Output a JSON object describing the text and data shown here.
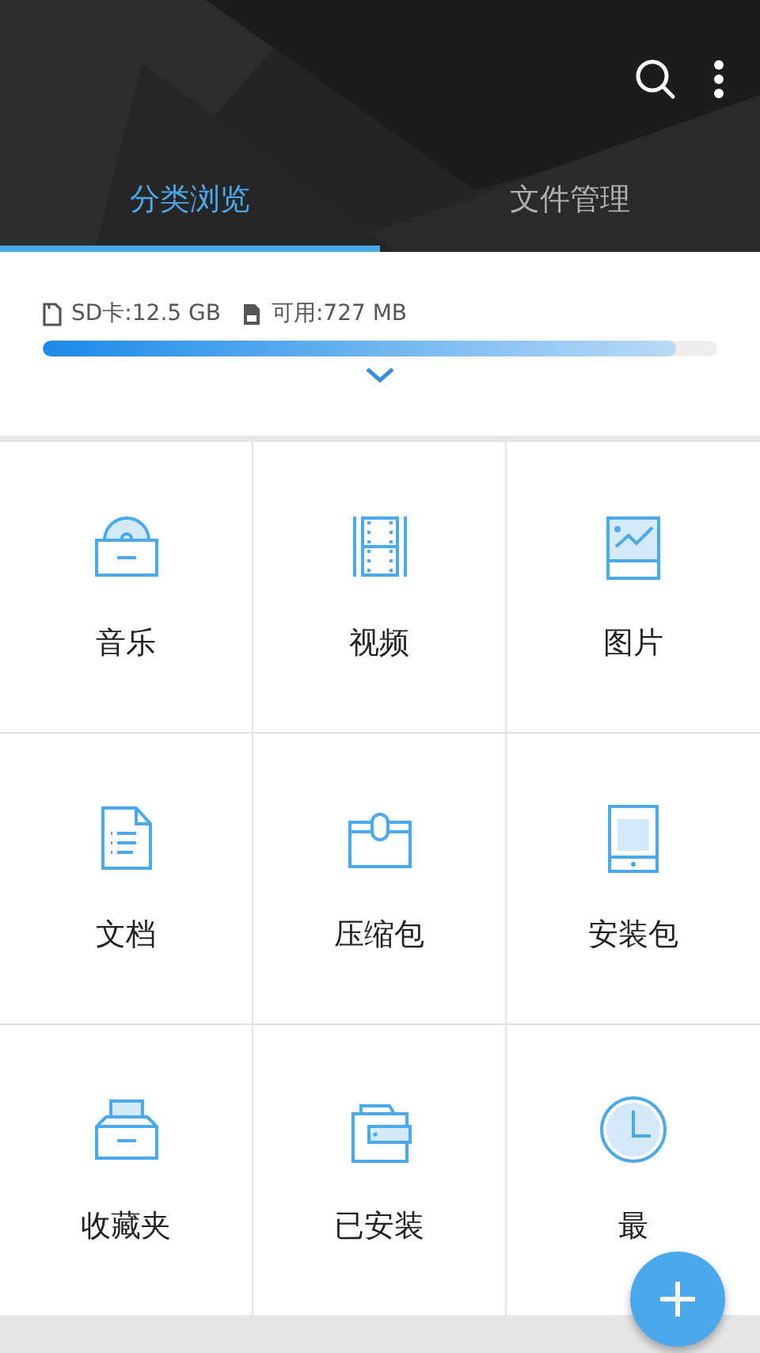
{
  "tabs": [
    {
      "label": "分类浏览",
      "selected": true
    },
    {
      "label": "文件管理",
      "selected": false
    }
  ],
  "storage": {
    "sd_label": "SD卡:12.5 GB",
    "free_label": "可用:727 MB",
    "level": 0.94
  },
  "categories": [
    {
      "kind": "music",
      "label": "音乐"
    },
    {
      "kind": "video",
      "label": "视频"
    },
    {
      "kind": "image",
      "label": "图片"
    },
    {
      "kind": "document",
      "label": "文档"
    },
    {
      "kind": "archive",
      "label": "压缩包"
    },
    {
      "kind": "apk",
      "label": "安装包"
    },
    {
      "kind": "favorites",
      "label": "收藏夹"
    },
    {
      "kind": "installed",
      "label": "已安装"
    },
    {
      "kind": "recent",
      "label": "最"
    }
  ]
}
